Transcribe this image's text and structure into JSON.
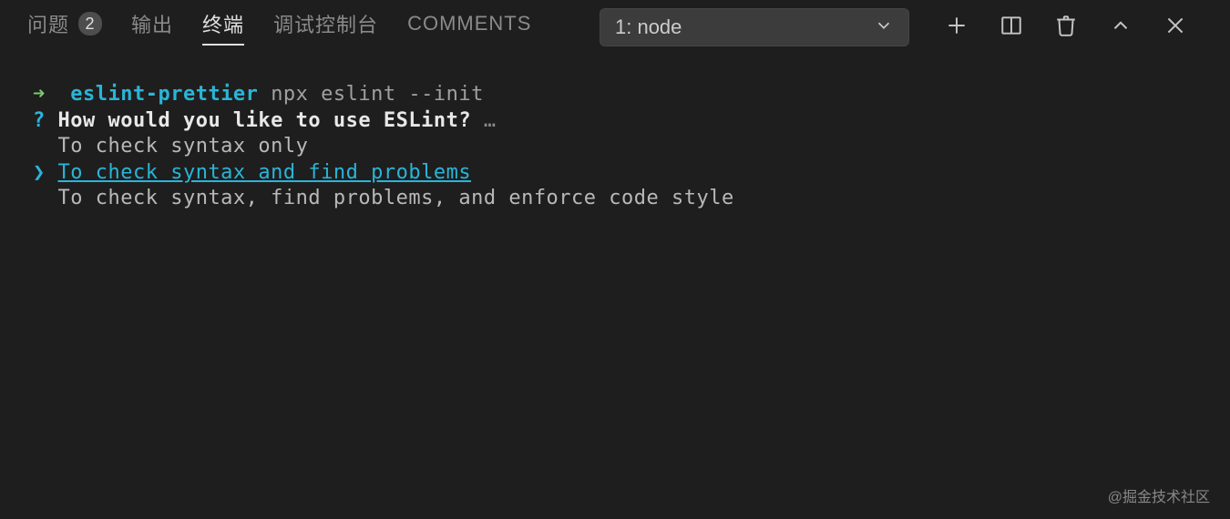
{
  "tabs": {
    "problems": {
      "label": "问题",
      "badge": "2"
    },
    "output": {
      "label": "输出"
    },
    "terminal": {
      "label": "终端"
    },
    "debug": {
      "label": "调试控制台"
    },
    "comments": {
      "label": "COMMENTS"
    }
  },
  "dropdown": {
    "selected": "1: node"
  },
  "terminal": {
    "prompt_arrow": "➜",
    "prompt_dir": "eslint-prettier",
    "command": "npx eslint --init",
    "qmark": "?",
    "question": "How would you like to use ESLint?",
    "ellipsis": "…",
    "options": {
      "opt1": "To check syntax only",
      "opt2": "To check syntax and find problems",
      "opt3": "To check syntax, find problems, and enforce code style"
    },
    "selected_marker": "❯"
  },
  "watermark": "@掘金技术社区"
}
